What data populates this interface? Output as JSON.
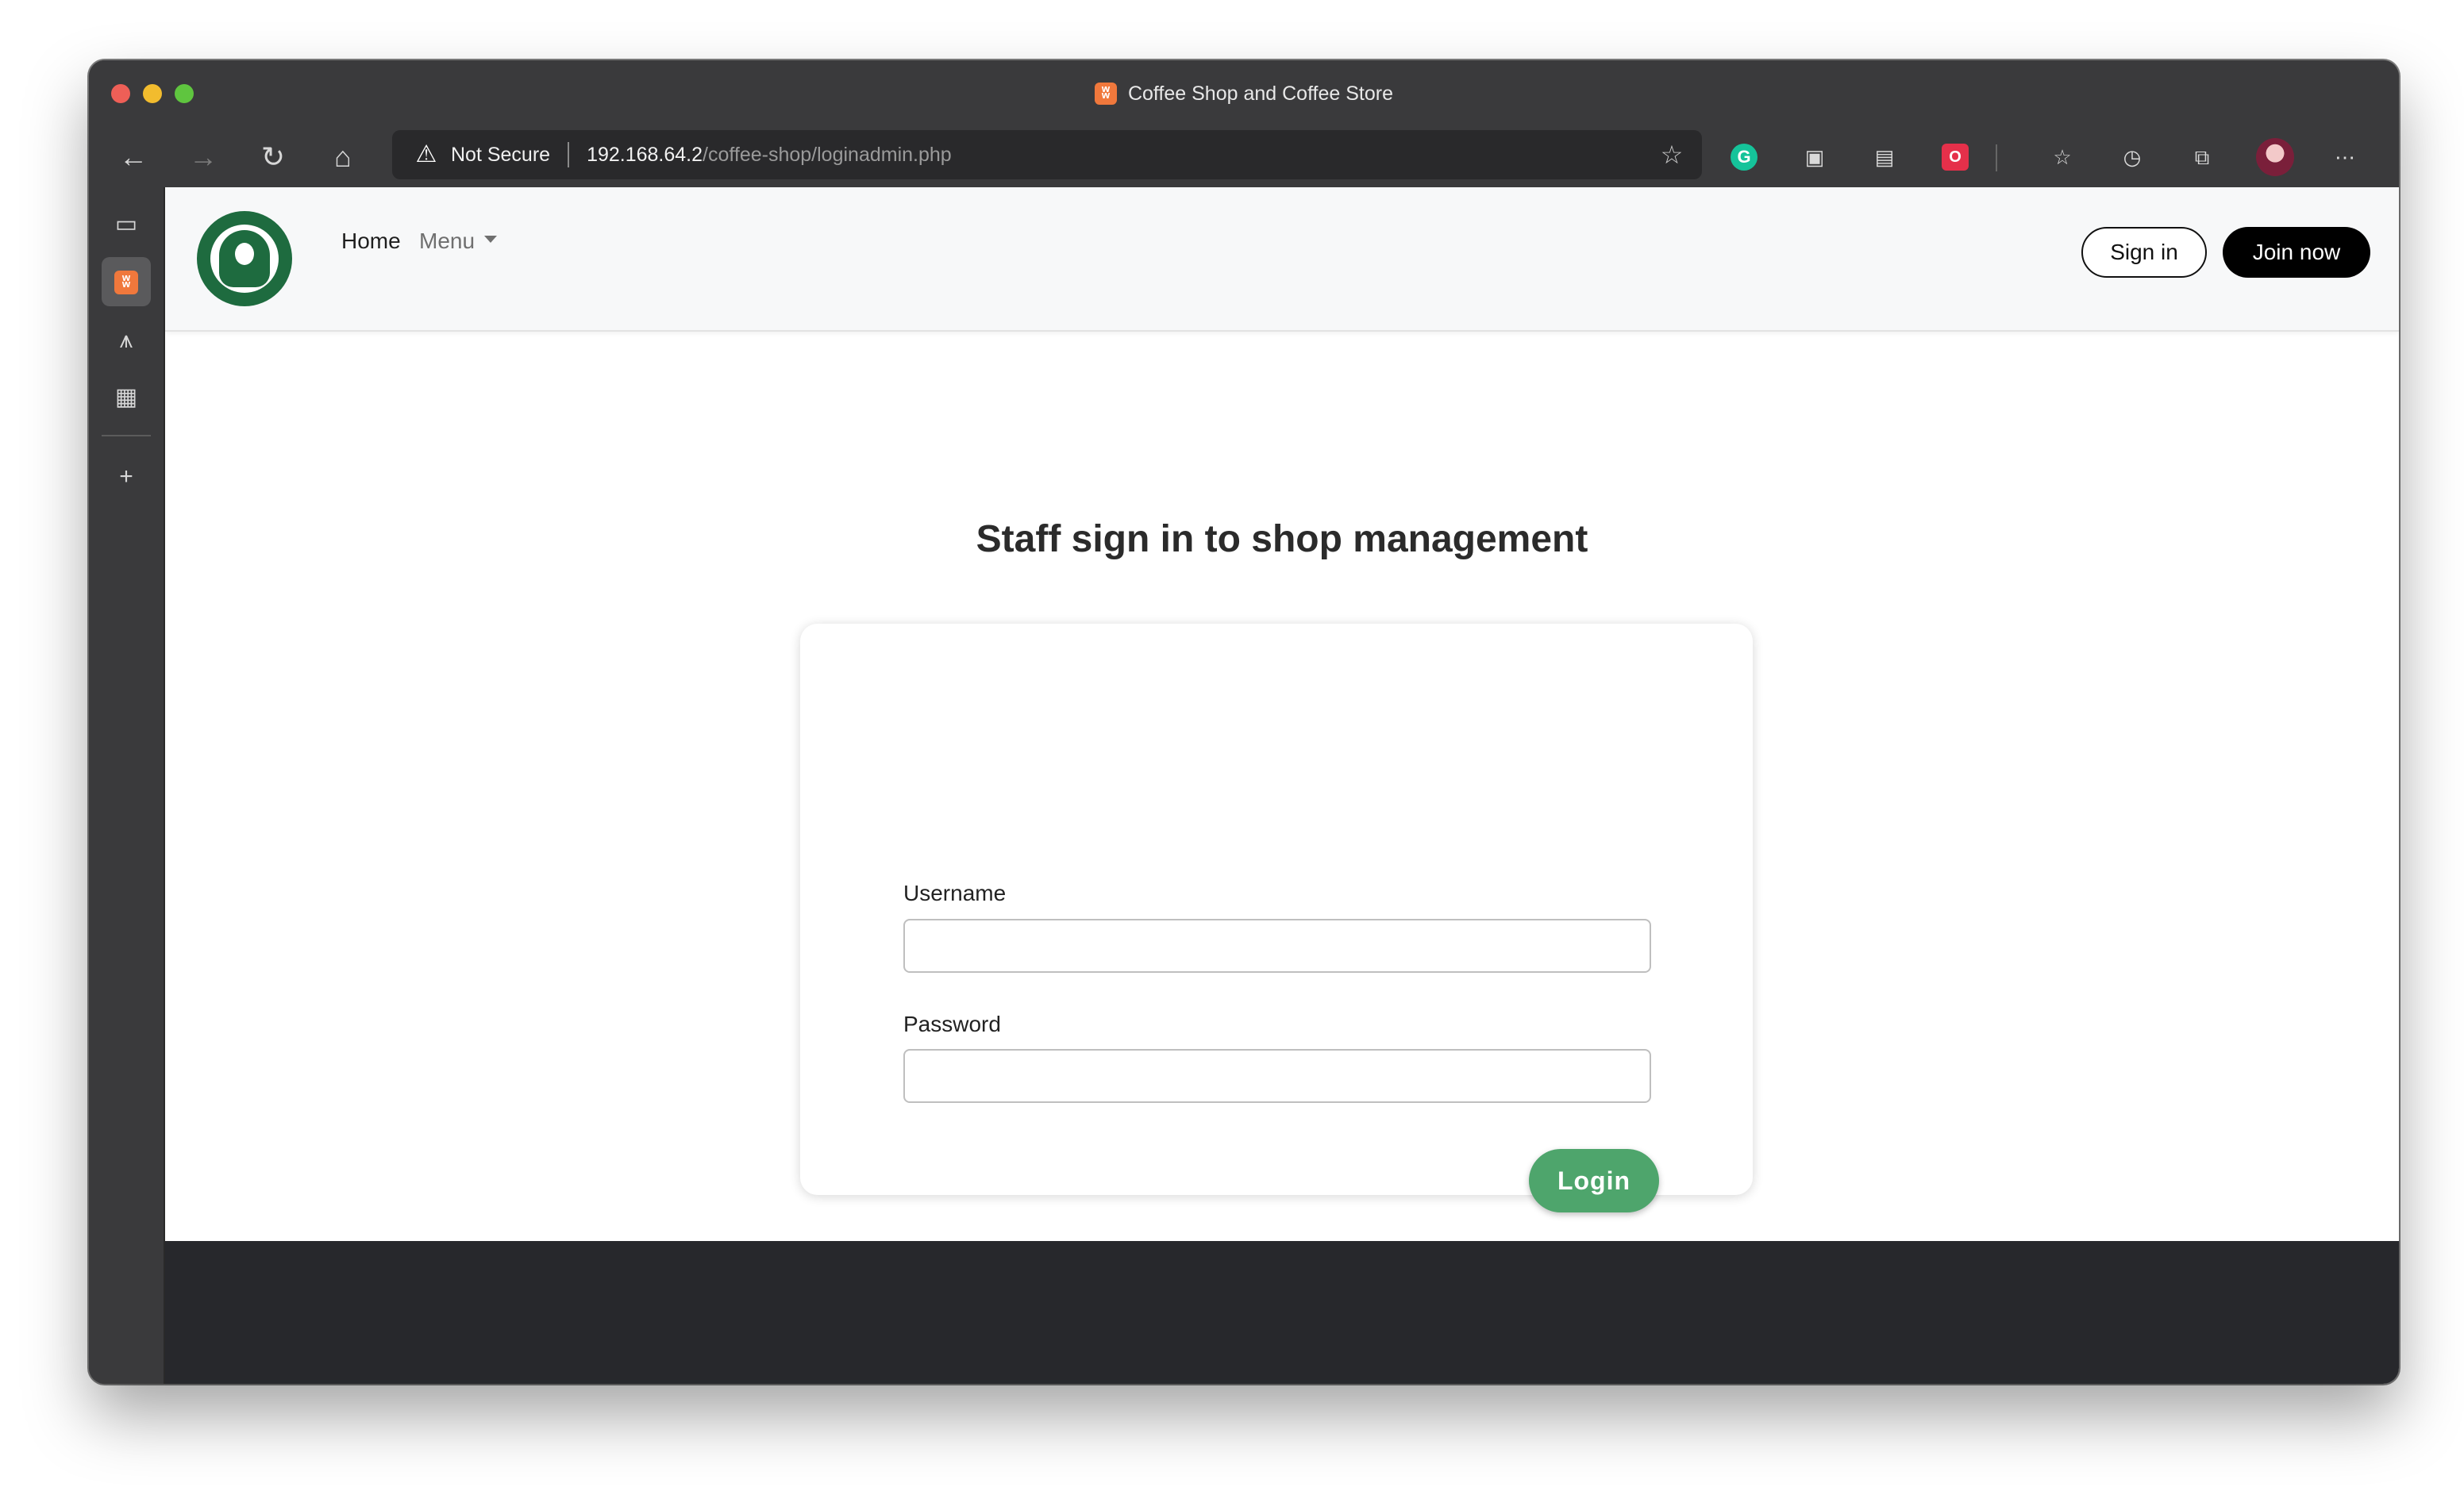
{
  "browser": {
    "tab_title": "Coffee Shop and Coffee Store",
    "tab_icon": "xampp-icon",
    "address": {
      "security_label": "Not Secure",
      "url_host": "192.168.64.2",
      "url_path": "/coffee-shop/loginadmin.php"
    },
    "toolbar_icons": [
      "back-icon",
      "forward-icon",
      "refresh-icon",
      "home-icon",
      "add-favorite-icon",
      "grammarly-icon",
      "extension-icon",
      "extension-icon",
      "extension-icon",
      "favorites-icon",
      "history-icon",
      "collections-icon",
      "profile-avatar",
      "more-icon"
    ],
    "sidebar_icons": [
      "tab-icon",
      "xampp-icon",
      "tab-icon",
      "tab-icon",
      "new-tab-icon"
    ]
  },
  "site": {
    "nav": {
      "home_label": "Home",
      "menu_label": "Menu",
      "signin_label": "Sign in",
      "join_label": "Join now"
    },
    "heading": "Staff sign in to shop management",
    "form": {
      "username_label": "Username",
      "username_value": "",
      "password_label": "Password",
      "password_value": "",
      "login_label": "Login"
    }
  },
  "colors": {
    "brand_green": "#1e6b3f",
    "login_button": "#4ea56c",
    "footer": "#27282c",
    "join_button": "#000000"
  }
}
